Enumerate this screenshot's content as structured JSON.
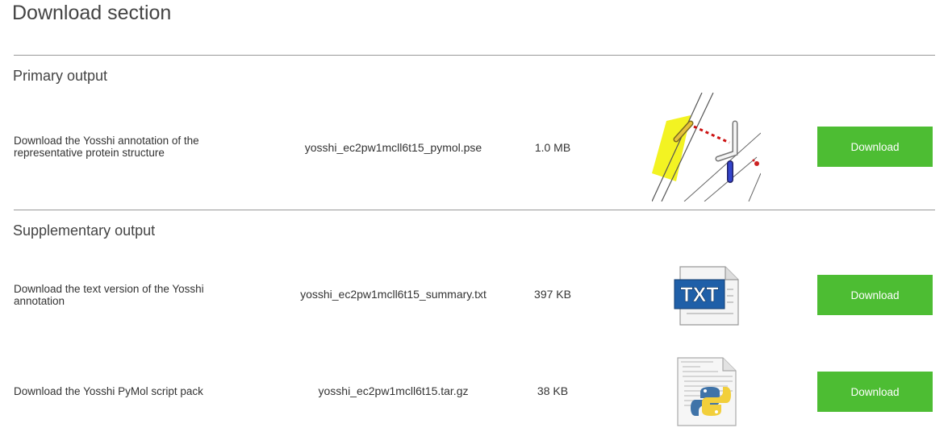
{
  "page_title": "Download section",
  "sections": {
    "primary": {
      "title": "Primary output",
      "rows": [
        {
          "description": "Download the Yosshi annotation of the representative protein structure",
          "filename": "yosshi_ec2pw1mcll6t15_pymol.pse",
          "size": "1.0 MB",
          "thumbnail": "protein-structure-preview",
          "button": "Download"
        }
      ]
    },
    "supplementary": {
      "title": "Supplementary output",
      "rows": [
        {
          "description": "Download the text version of the Yosshi annotation",
          "filename": "yosshi_ec2pw1mcll6t15_summary.txt",
          "size": "397 KB",
          "thumbnail": "txt-file-icon",
          "icon_text": "TXT",
          "button": "Download"
        },
        {
          "description": "Download the Yosshi PyMol script pack",
          "filename": "yosshi_ec2pw1mcll6t15.tar.gz",
          "size": "38 KB",
          "thumbnail": "python-script-file-icon",
          "button": "Download"
        }
      ]
    }
  },
  "colors": {
    "button_bg": "#4dbd33",
    "button_text": "#ffffff",
    "rule": "#999999",
    "txt_icon_blue": "#1f5fa8",
    "highlight_yellow": "#f2f20a"
  }
}
